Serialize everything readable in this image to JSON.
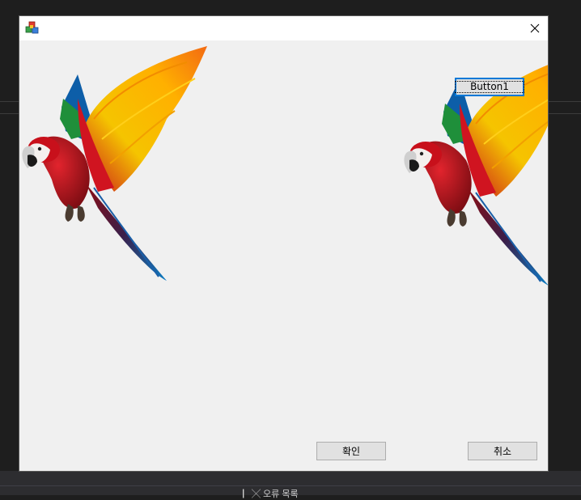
{
  "dialog": {
    "button1_label": "Button1",
    "ok_label": "확인",
    "cancel_label": "취소"
  },
  "taskbar": {
    "panel_text": "▏╳  오류 목록"
  },
  "icons": {
    "app": "app-cubes-icon",
    "close": "close-icon",
    "image": "parrot-image"
  },
  "colors": {
    "accent": "#0078d7",
    "dialog_bg": "#f0f0f0",
    "titlebar_bg": "#ffffff"
  }
}
